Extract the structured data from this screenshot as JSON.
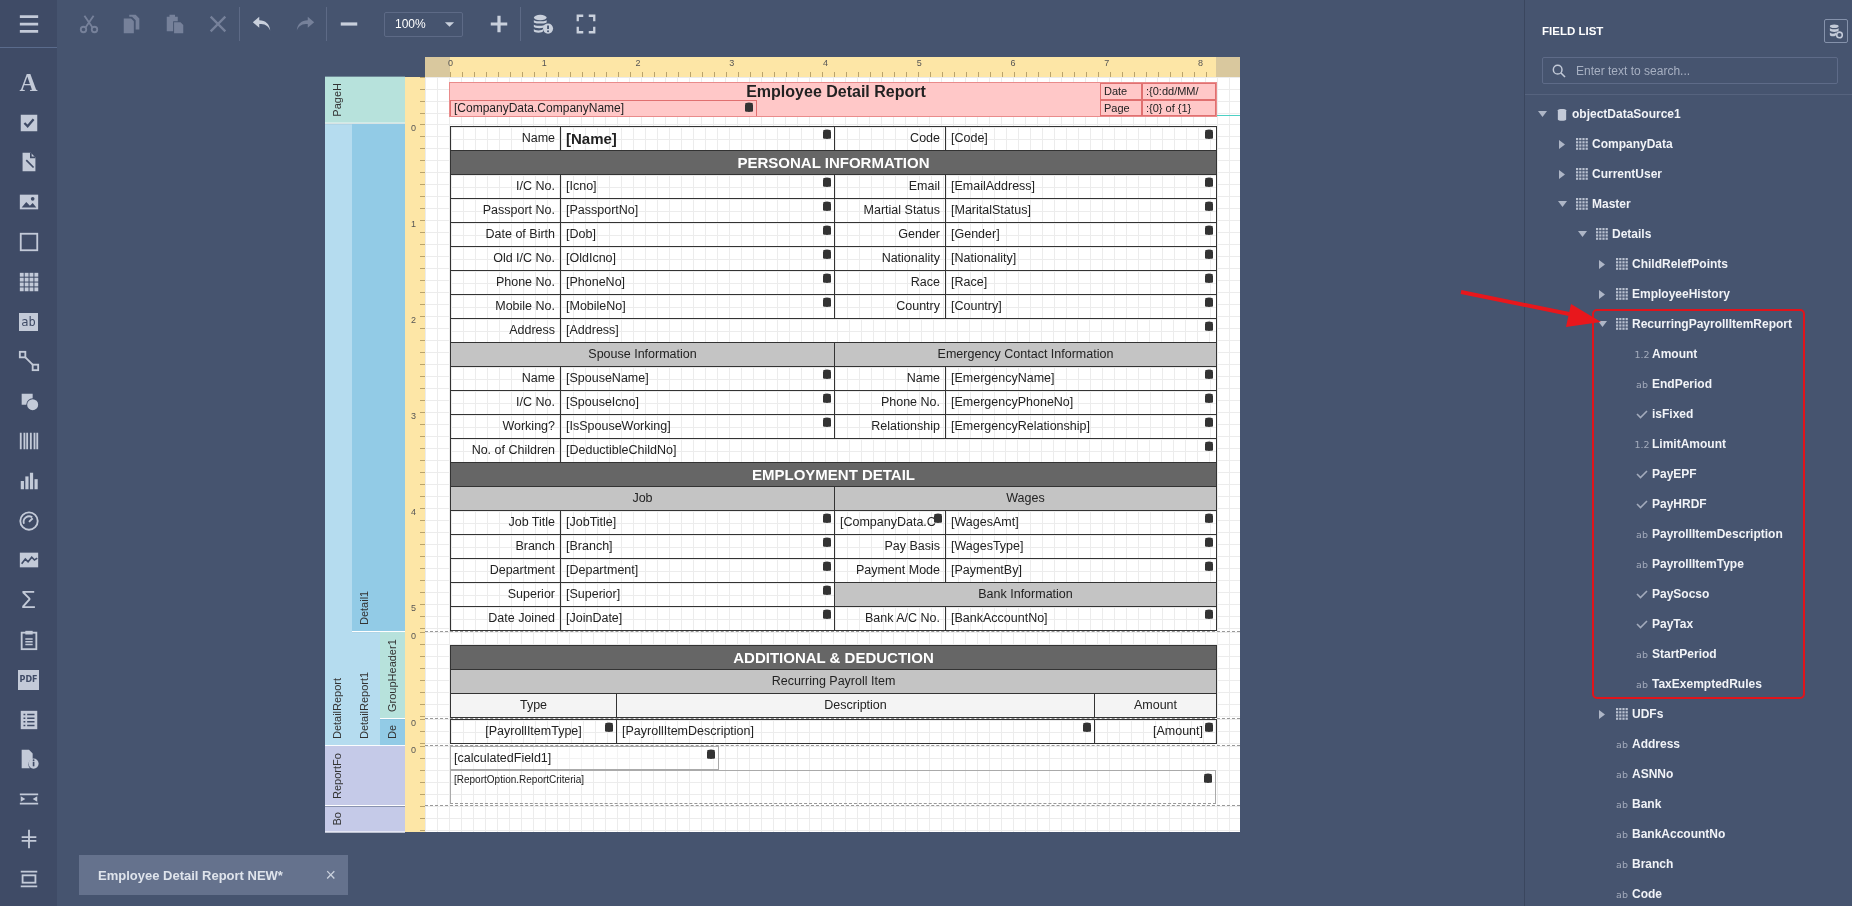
{
  "toolbar": {
    "groups": [
      {
        "items": [
          {
            "kind": "cut",
            "disabled": true
          },
          {
            "kind": "copy",
            "disabled": true
          },
          {
            "kind": "paste",
            "disabled": true
          },
          {
            "kind": "delete",
            "disabled": true
          }
        ]
      },
      {
        "items": [
          {
            "kind": "undo",
            "disabled": false
          },
          {
            "kind": "redo",
            "disabled": true
          }
        ]
      },
      {
        "items": [
          {
            "kind": "zoom_out",
            "disabled": false
          },
          {
            "kind": "zoom_select",
            "value": "100%",
            "disabled": false
          },
          {
            "kind": "zoom_in",
            "disabled": false
          }
        ]
      },
      {
        "items": [
          {
            "kind": "validate",
            "disabled": false
          },
          {
            "kind": "fullscreen",
            "disabled": false
          }
        ]
      }
    ]
  },
  "toolbox": [
    {
      "kind": "text",
      "glyph": "A"
    },
    {
      "kind": "checkbox"
    },
    {
      "kind": "rich_text"
    },
    {
      "kind": "picture"
    },
    {
      "kind": "panel"
    },
    {
      "kind": "table"
    },
    {
      "kind": "label",
      "glyph": "ab"
    },
    {
      "kind": "line"
    },
    {
      "kind": "shape"
    },
    {
      "kind": "barcode"
    },
    {
      "kind": "chart"
    },
    {
      "kind": "gauge"
    },
    {
      "kind": "sparkline"
    },
    {
      "kind": "summary",
      "glyph": "Σ"
    },
    {
      "kind": "subreport"
    },
    {
      "kind": "pdf",
      "glyph": "PDF"
    },
    {
      "kind": "toc"
    },
    {
      "kind": "page_info"
    },
    {
      "kind": "page_break"
    },
    {
      "kind": "cross_line"
    },
    {
      "kind": "cross_box"
    }
  ],
  "report": {
    "ruler": [
      "0",
      "1",
      "2",
      "3",
      "4",
      "5",
      "6",
      "7",
      "8"
    ],
    "bands": [
      {
        "kind": "page_header",
        "label": "PageH",
        "title": "Employee Detail Report",
        "field": "[CompanyData.CompanyName]",
        "info": [
          {
            "label": "Date",
            "value": ":{0:dd/MM/"
          },
          {
            "label": "Page",
            "value": ":{0} of {1}"
          }
        ]
      },
      {
        "kind": "detail_report",
        "label": "DetailReport",
        "children": [
          {
            "kind": "detail",
            "label": "Detail1",
            "ruler": [
              "0",
              "1",
              "2",
              "3",
              "4",
              "5"
            ],
            "rows": [
              {
                "kind": "quad",
                "cells": [
                  {
                    "kind": "label",
                    "text": "Name"
                  },
                  {
                    "kind": "value_bold",
                    "text": "[Name]"
                  },
                  {
                    "kind": "label",
                    "text": "Code"
                  },
                  {
                    "kind": "value",
                    "text": "[Code]"
                  }
                ]
              },
              {
                "kind": "quad_full",
                "cells": [
                  {
                    "kind": "section",
                    "text": "PERSONAL INFORMATION"
                  }
                ]
              },
              {
                "kind": "quad",
                "cells": [
                  {
                    "kind": "label",
                    "text": "I/C No."
                  },
                  {
                    "kind": "value",
                    "text": "[Icno]"
                  },
                  {
                    "kind": "label",
                    "text": "Email"
                  },
                  {
                    "kind": "value",
                    "text": "[EmailAddress]"
                  }
                ]
              },
              {
                "kind": "quad",
                "cells": [
                  {
                    "kind": "label",
                    "text": "Passport No."
                  },
                  {
                    "kind": "value",
                    "text": "[PassportNo]"
                  },
                  {
                    "kind": "label",
                    "text": "Martial Status"
                  },
                  {
                    "kind": "value",
                    "text": "[MaritalStatus]"
                  }
                ]
              },
              {
                "kind": "quad",
                "cells": [
                  {
                    "kind": "label",
                    "text": "Date of Birth"
                  },
                  {
                    "kind": "value",
                    "text": "[Dob]"
                  },
                  {
                    "kind": "label",
                    "text": "Gender"
                  },
                  {
                    "kind": "value",
                    "text": "[Gender]"
                  }
                ]
              },
              {
                "kind": "quad",
                "cells": [
                  {
                    "kind": "label",
                    "text": "Old I/C No."
                  },
                  {
                    "kind": "value",
                    "text": "[OldIcno]"
                  },
                  {
                    "kind": "label",
                    "text": "Nationality"
                  },
                  {
                    "kind": "value",
                    "text": "[Nationality]"
                  }
                ]
              },
              {
                "kind": "quad",
                "cells": [
                  {
                    "kind": "label",
                    "text": "Phone No."
                  },
                  {
                    "kind": "value",
                    "text": "[PhoneNo]"
                  },
                  {
                    "kind": "label",
                    "text": "Race"
                  },
                  {
                    "kind": "value",
                    "text": "[Race]"
                  }
                ]
              },
              {
                "kind": "quad",
                "cells": [
                  {
                    "kind": "label",
                    "text": "Mobile No."
                  },
                  {
                    "kind": "value",
                    "text": "[MobileNo]"
                  },
                  {
                    "kind": "label",
                    "text": "Country"
                  },
                  {
                    "kind": "value",
                    "text": "[Country]"
                  }
                ]
              },
              {
                "kind": "quad_wide",
                "cells": [
                  {
                    "kind": "label",
                    "text": "Address"
                  },
                  {
                    "kind": "value",
                    "text": "[Address]"
                  }
                ]
              },
              {
                "kind": "quad_halves",
                "cells": [
                  {
                    "kind": "subheader",
                    "text": "Spouse Information"
                  },
                  {
                    "kind": "subheader",
                    "text": "Emergency Contact Information"
                  }
                ]
              },
              {
                "kind": "quad",
                "cells": [
                  {
                    "kind": "label",
                    "text": "Name"
                  },
                  {
                    "kind": "value",
                    "text": "[SpouseName]"
                  },
                  {
                    "kind": "label",
                    "text": "Name"
                  },
                  {
                    "kind": "value",
                    "text": "[EmergencyName]"
                  }
                ]
              },
              {
                "kind": "quad",
                "cells": [
                  {
                    "kind": "label",
                    "text": "I/C No."
                  },
                  {
                    "kind": "value",
                    "text": "[SpouseIcno]"
                  },
                  {
                    "kind": "label",
                    "text": "Phone No."
                  },
                  {
                    "kind": "value",
                    "text": "[EmergencyPhoneNo]"
                  }
                ]
              },
              {
                "kind": "quad",
                "cells": [
                  {
                    "kind": "label",
                    "text": "Working?"
                  },
                  {
                    "kind": "value",
                    "text": "[IsSpouseWorking]"
                  },
                  {
                    "kind": "label",
                    "text": "Relationship"
                  },
                  {
                    "kind": "value",
                    "text": "[EmergencyRelationship]"
                  }
                ]
              },
              {
                "kind": "quad_wide",
                "cells": [
                  {
                    "kind": "label",
                    "text": "No. of Children"
                  },
                  {
                    "kind": "value",
                    "text": "[DeductibleChildNo]"
                  }
                ]
              },
              {
                "kind": "quad_full",
                "cells": [
                  {
                    "kind": "section",
                    "text": "EMPLOYMENT DETAIL"
                  }
                ]
              },
              {
                "kind": "quad_halves",
                "cells": [
                  {
                    "kind": "subheader",
                    "text": "Job"
                  },
                  {
                    "kind": "subheader",
                    "text": "Wages"
                  }
                ]
              },
              {
                "kind": "quad",
                "cells": [
                  {
                    "kind": "label",
                    "text": "Job Title"
                  },
                  {
                    "kind": "value",
                    "text": "[JobTitle]"
                  },
                  {
                    "kind": "value",
                    "text": "[CompanyData.C"
                  },
                  {
                    "kind": "value",
                    "text": "[WagesAmt]"
                  }
                ]
              },
              {
                "kind": "quad",
                "cells": [
                  {
                    "kind": "label",
                    "text": "Branch"
                  },
                  {
                    "kind": "value",
                    "text": "[Branch]"
                  },
                  {
                    "kind": "label",
                    "text": "Pay Basis"
                  },
                  {
                    "kind": "value",
                    "text": "[WagesType]"
                  }
                ]
              },
              {
                "kind": "quad",
                "cells": [
                  {
                    "kind": "label",
                    "text": "Department"
                  },
                  {
                    "kind": "value",
                    "text": "[Department]"
                  },
                  {
                    "kind": "label",
                    "text": "Payment Mode"
                  },
                  {
                    "kind": "value",
                    "text": "[PaymentBy]"
                  }
                ]
              },
              {
                "kind": "quad_pair_half",
                "cells": [
                  {
                    "kind": "label",
                    "text": "Superior"
                  },
                  {
                    "kind": "value",
                    "text": "[Superior]"
                  },
                  {
                    "kind": "subheader",
                    "text": "Bank Information"
                  }
                ]
              },
              {
                "kind": "quad",
                "cells": [
                  {
                    "kind": "label",
                    "text": "Date Joined"
                  },
                  {
                    "kind": "value",
                    "text": "[JoinDate]"
                  },
                  {
                    "kind": "label",
                    "text": "Bank A/C No."
                  },
                  {
                    "kind": "value",
                    "text": "[BankAccountNo]"
                  }
                ]
              }
            ]
          },
          {
            "kind": "detail_report",
            "label": "DetailReport1",
            "children": [
              {
                "kind": "group_header",
                "label": "GroupHeader1",
                "ruler": [
                  "0"
                ],
                "rows": [
                  {
                    "kind": "triple_full",
                    "cells": [
                      {
                        "kind": "section",
                        "text": "ADDITIONAL & DEDUCTION"
                      }
                    ]
                  },
                  {
                    "kind": "triple_full",
                    "cells": [
                      {
                        "kind": "subheader",
                        "text": "Recurring Payroll Item"
                      }
                    ]
                  },
                  {
                    "kind": "triple",
                    "cells": [
                      {
                        "kind": "column_header",
                        "text": "Type"
                      },
                      {
                        "kind": "column_header",
                        "text": "Description"
                      },
                      {
                        "kind": "column_header",
                        "text": "Amount"
                      }
                    ]
                  }
                ]
              },
              {
                "kind": "detail",
                "label": "De",
                "ruler": [
                  "0"
                ],
                "rows": [
                  {
                    "kind": "triple",
                    "cells": [
                      {
                        "kind": "value_center",
                        "text": "[PayrollItemType]"
                      },
                      {
                        "kind": "value",
                        "text": "[PayrollItemDescription]"
                      },
                      {
                        "kind": "value_right",
                        "text": "[Amount]"
                      }
                    ]
                  }
                ]
              }
            ]
          }
        ]
      },
      {
        "kind": "report_footer",
        "label": "ReportFo",
        "ruler": [
          "0"
        ],
        "fields": [
          {
            "kind": "field",
            "text": "[calculatedField1]"
          },
          {
            "kind": "criteria",
            "text": "[ReportOption.ReportCriteria]"
          }
        ]
      },
      {
        "kind": "bottom_margin",
        "label": "Bo"
      }
    ]
  },
  "field_list": {
    "title": "FIELD LIST",
    "search": {
      "placeholder": "Enter text to search..."
    },
    "tree": [
      {
        "kind": "datasource",
        "label": "objectDataSource1",
        "expanded": true,
        "children": [
          {
            "kind": "table",
            "label": "CompanyData",
            "expanded": false
          },
          {
            "kind": "table",
            "label": "CurrentUser",
            "expanded": false
          },
          {
            "kind": "table",
            "label": "Master",
            "expanded": true,
            "children": [
              {
                "kind": "table",
                "label": "Details",
                "expanded": true,
                "children": [
                  {
                    "kind": "table",
                    "label": "ChildRelefPoints",
                    "expanded": false
                  },
                  {
                    "kind": "table",
                    "label": "EmployeeHistory",
                    "expanded": false
                  },
                  {
                    "kind": "table",
                    "label": "RecurringPayrollItemReport",
                    "expanded": true,
                    "highlighted": true,
                    "children": [
                      {
                        "kind": "number",
                        "glyph": "1.2",
                        "label": "Amount"
                      },
                      {
                        "kind": "string",
                        "glyph": "ab",
                        "label": "EndPeriod"
                      },
                      {
                        "kind": "boolean",
                        "label": "isFixed"
                      },
                      {
                        "kind": "number",
                        "glyph": "1.2",
                        "label": "LimitAmount"
                      },
                      {
                        "kind": "boolean",
                        "label": "PayEPF"
                      },
                      {
                        "kind": "boolean",
                        "label": "PayHRDF"
                      },
                      {
                        "kind": "string",
                        "glyph": "ab",
                        "label": "PayrollItemDescription"
                      },
                      {
                        "kind": "string",
                        "glyph": "ab",
                        "label": "PayrollItemType"
                      },
                      {
                        "kind": "boolean",
                        "label": "PaySocso"
                      },
                      {
                        "kind": "boolean",
                        "label": "PayTax"
                      },
                      {
                        "kind": "string",
                        "glyph": "ab",
                        "label": "StartPeriod"
                      },
                      {
                        "kind": "string",
                        "glyph": "ab",
                        "label": "TaxExemptedRules"
                      }
                    ]
                  },
                  {
                    "kind": "table",
                    "label": "UDFs",
                    "expanded": false
                  },
                  {
                    "kind": "string",
                    "glyph": "ab",
                    "label": "Address"
                  },
                  {
                    "kind": "string",
                    "glyph": "ab",
                    "label": "ASNNo"
                  },
                  {
                    "kind": "string",
                    "glyph": "ab",
                    "label": "Bank"
                  },
                  {
                    "kind": "string",
                    "glyph": "ab",
                    "label": "BankAccountNo"
                  },
                  {
                    "kind": "string",
                    "glyph": "ab",
                    "label": "Branch"
                  },
                  {
                    "kind": "string",
                    "glyph": "ab",
                    "label": "Code"
                  }
                ]
              }
            ]
          }
        ]
      }
    ]
  },
  "document_tabs": [
    {
      "label": "Employee Detail Report NEW*",
      "close": "×",
      "selected": true
    }
  ]
}
